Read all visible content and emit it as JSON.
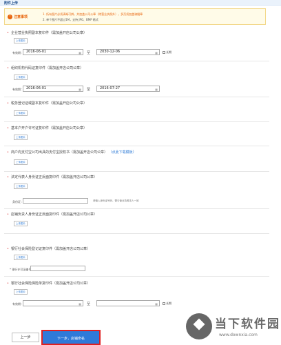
{
  "header": {
    "title": "附件上传"
  },
  "notice": {
    "title": "注意事项",
    "icon": "warning-icon",
    "line1": "1. 所有图片必须清晰可辨，并加盖公司公章（除营业执照外），多页须加盖骑缝章",
    "line2": "2. 单个图片不超过1M，支持 JPG、BMP 格式"
  },
  "sections": [
    {
      "title": "企业营业执照副本复印件（需加盖开店公司公章）",
      "upload": "上传图片"
    },
    {
      "title": "组织机构代码证复印件（需加盖开店公司公章）",
      "upload": "上传图片"
    },
    {
      "title": "税务登记证或副本复印件（需加盖开店公司公章）",
      "upload": "上传图片"
    },
    {
      "title": "基本户开户许可证复印件（需加盖开店公司公章）",
      "upload": "上传图片"
    },
    {
      "title": "商户向支付宝公司出具的支付宝授权书（需加盖开店公司公章）",
      "link": "点此下载模板",
      "upload": "上传图片"
    },
    {
      "title": "法定代表人身份证正反面复印件（需加盖开店公司公章）",
      "upload": "上传图片"
    },
    {
      "title": "店铺负责人身份证正反面复印件（需加盖开店公司公章）",
      "upload": "上传图片"
    },
    {
      "title": "银行社会保险登记证复印件（需加盖开店公司公章）",
      "upload": "上传图片"
    },
    {
      "title": "银行社会保险保险单复印件（需加盖开店公司公章）",
      "upload": "上传图片"
    }
  ],
  "fields": {
    "validity_label": "有效期：",
    "date1_start": "2016-06-01",
    "date1_end": "2030-12-06",
    "date2_start": "2016-06-01",
    "date2_end": "2016-07-27",
    "to": "至",
    "long_term": "长期",
    "id_label": "身份证：",
    "id_hint": "请输入身份证号码，需与营业执照法人一致",
    "license_label": "* 银行许可证编号："
  },
  "footer": {
    "prev": "上一步",
    "next": "下一步，店铺命名"
  },
  "watermark": {
    "title": "当下软件园",
    "sub": "www.downxia.com"
  }
}
